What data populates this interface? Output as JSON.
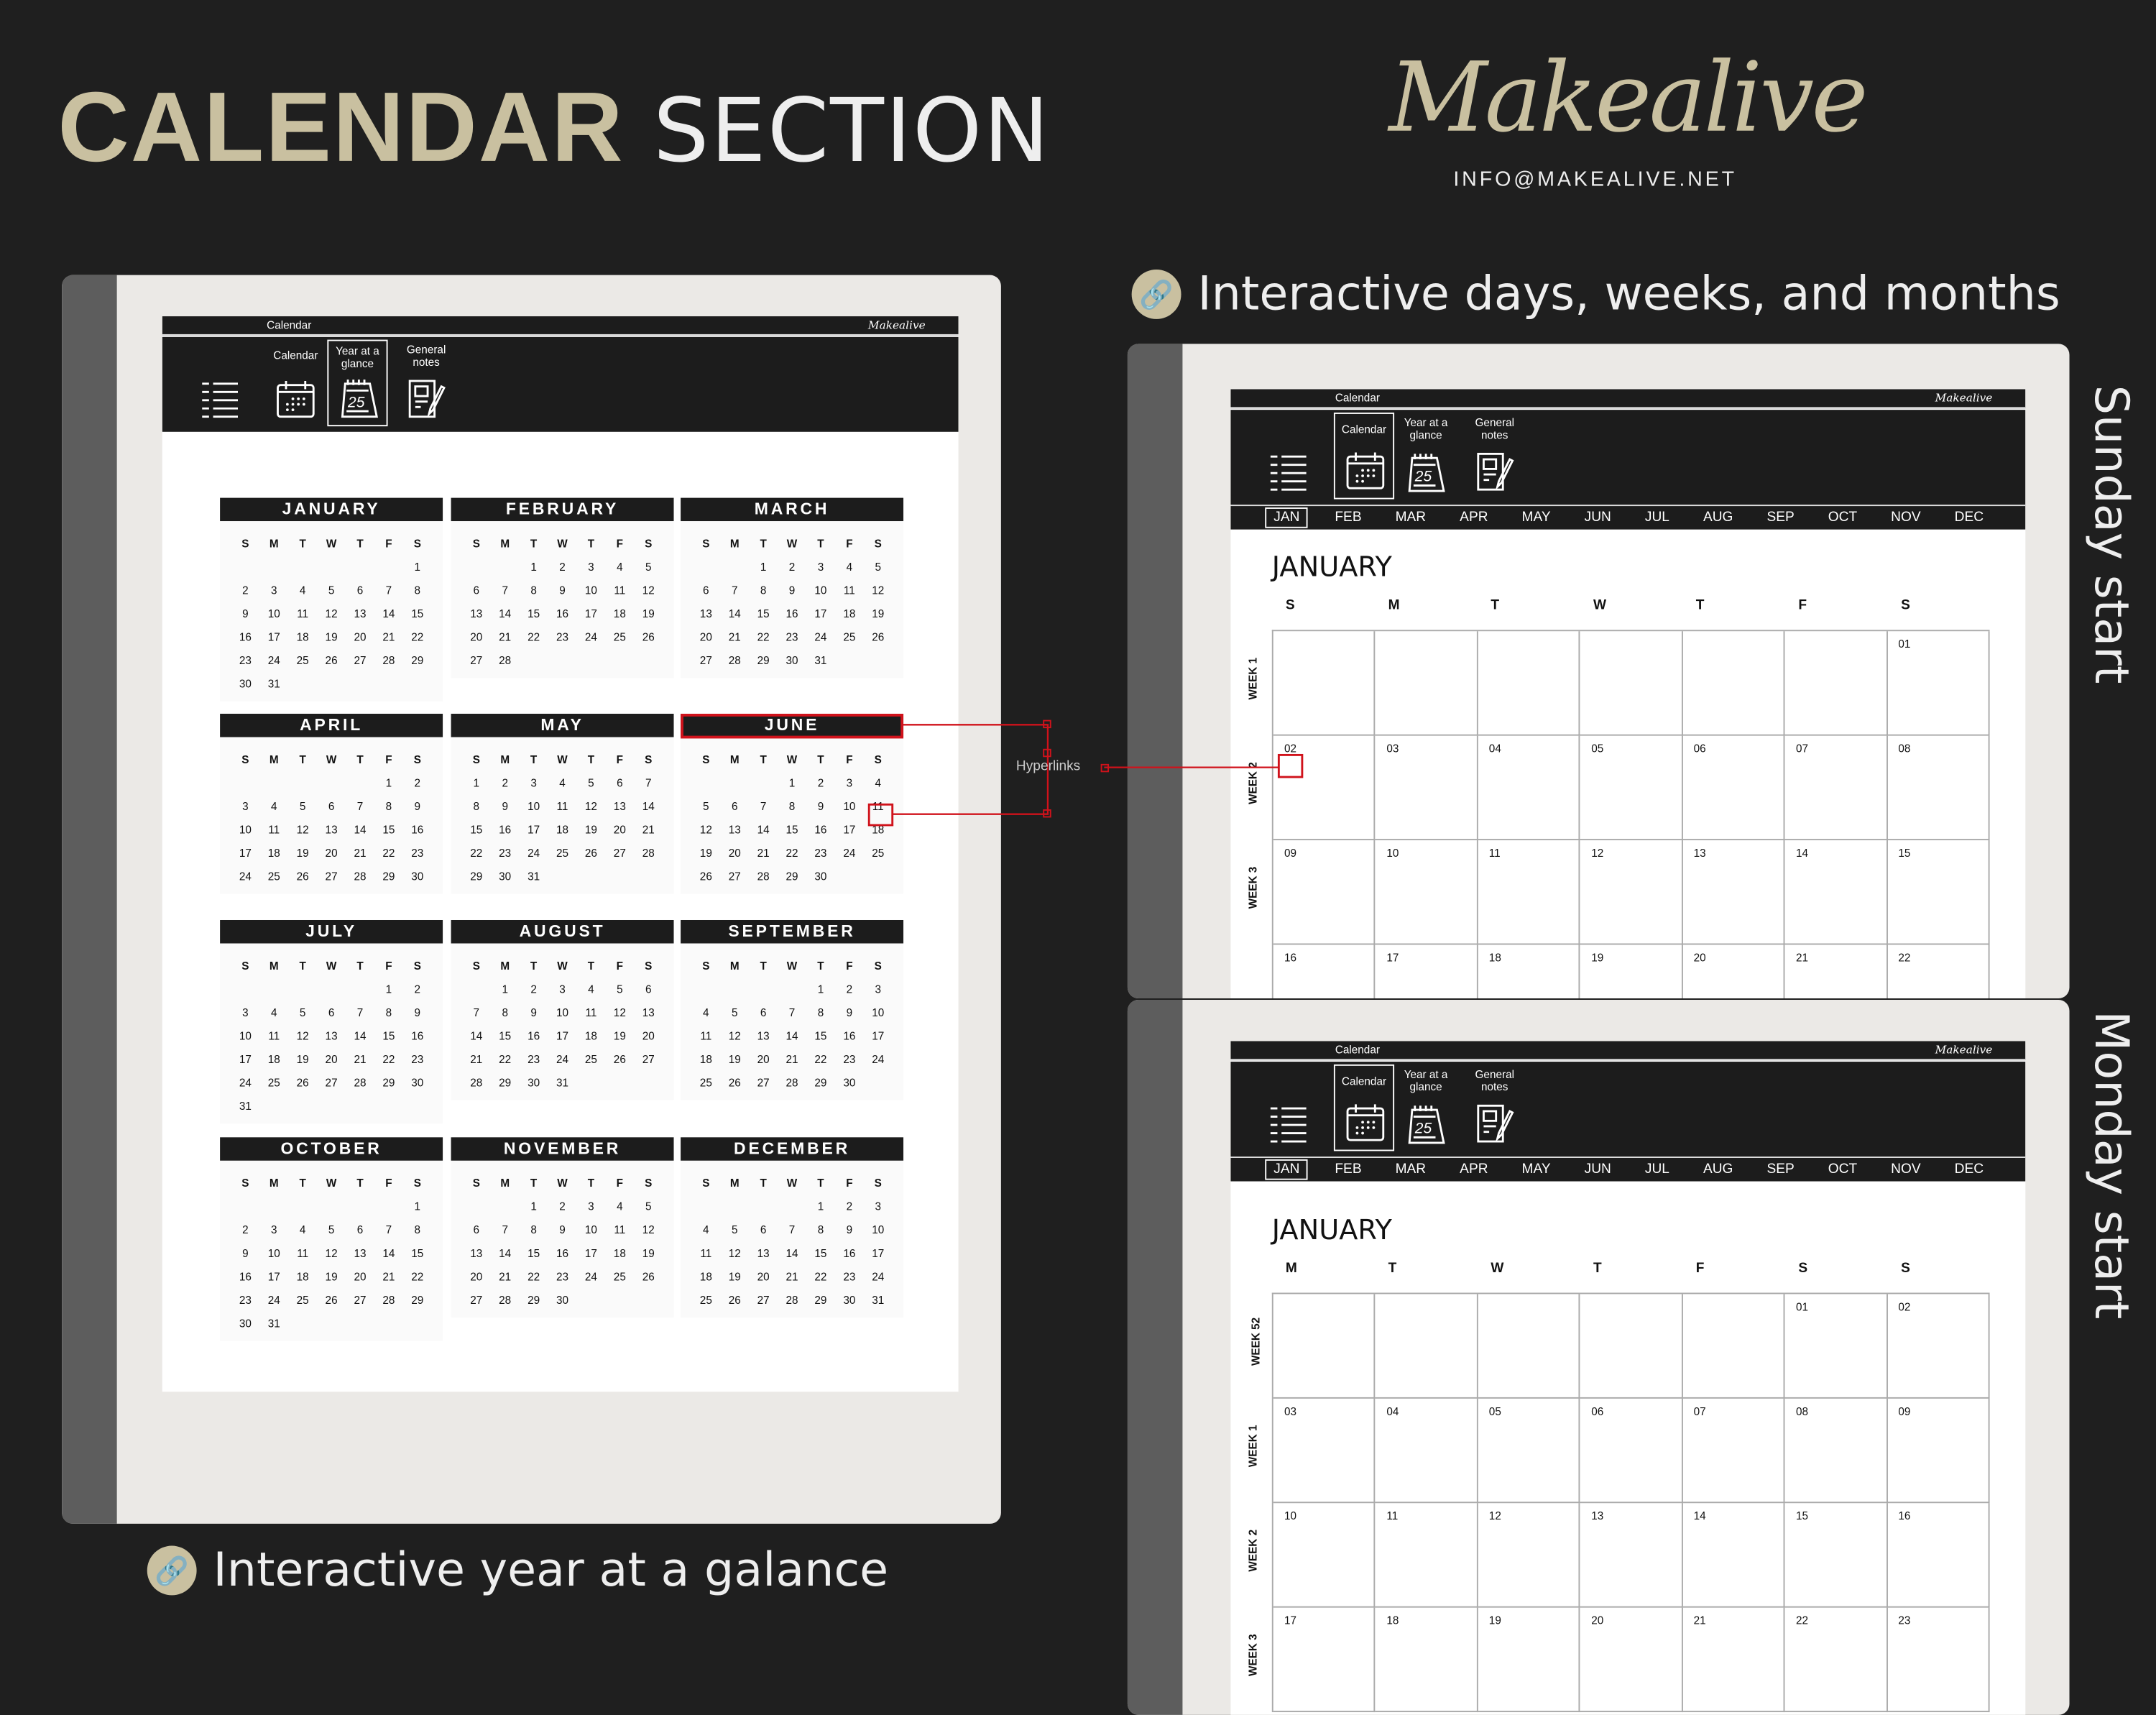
{
  "header": {
    "title_bold": "CALENDAR",
    "title_light": "SECTION",
    "brand": "Makealive",
    "email": "INFO@MAKEALIVE.NET"
  },
  "colors": {
    "accent": "#c9c0a0",
    "background": "#1f1f1f",
    "highlight": "#d0121b"
  },
  "captions": {
    "year": "Interactive year at a galance",
    "weeks": "Interactive days, weeks, and months",
    "sunday": "Sunday start",
    "monday": "Monday start",
    "hyperlinks": "Hyperlinks"
  },
  "page_header": {
    "title": "Calendar",
    "brand": "Makealive",
    "nav": [
      {
        "label": "",
        "icon": "list-icon"
      },
      {
        "label": "Calendar",
        "icon": "calendar-icon"
      },
      {
        "label": "Year at a glance",
        "icon": "desk-calendar-icon"
      },
      {
        "label": "General notes",
        "icon": "notes-icon"
      }
    ]
  },
  "weekdays_sun": [
    "S",
    "M",
    "T",
    "W",
    "T",
    "F",
    "S"
  ],
  "weekdays_mon": [
    "M",
    "T",
    "W",
    "T",
    "F",
    "S",
    "S"
  ],
  "month_tabs": [
    "JAN",
    "FEB",
    "MAR",
    "APR",
    "MAY",
    "JUN",
    "JUL",
    "AUG",
    "SEP",
    "OCT",
    "NOV",
    "DEC"
  ],
  "year_months": [
    {
      "name": "JANUARY",
      "first_weekday": 6,
      "days": 31
    },
    {
      "name": "FEBRUARY",
      "first_weekday": 2,
      "days": 28
    },
    {
      "name": "MARCH",
      "first_weekday": 2,
      "days": 31
    },
    {
      "name": "APRIL",
      "first_weekday": 5,
      "days": 30
    },
    {
      "name": "MAY",
      "first_weekday": 0,
      "days": 31
    },
    {
      "name": "JUNE",
      "first_weekday": 3,
      "days": 30
    },
    {
      "name": "JULY",
      "first_weekday": 5,
      "days": 31
    },
    {
      "name": "AUGUST",
      "first_weekday": 1,
      "days": 31
    },
    {
      "name": "SEPTEMBER",
      "first_weekday": 4,
      "days": 30
    },
    {
      "name": "OCTOBER",
      "first_weekday": 6,
      "days": 31
    },
    {
      "name": "NOVEMBER",
      "first_weekday": 2,
      "days": 30
    },
    {
      "name": "DECEMBER",
      "first_weekday": 4,
      "days": 31
    }
  ],
  "sunday_view": {
    "month": "JANUARY",
    "selected_tab": "JAN",
    "weeks": [
      {
        "label": "WEEK 1",
        "days": [
          "",
          "",
          "",
          "",
          "",
          "",
          "01"
        ]
      },
      {
        "label": "WEEK 2",
        "days": [
          "02",
          "03",
          "04",
          "05",
          "06",
          "07",
          "08"
        ]
      },
      {
        "label": "WEEK 3",
        "days": [
          "09",
          "10",
          "11",
          "12",
          "13",
          "14",
          "15"
        ]
      },
      {
        "label": "",
        "days": [
          "16",
          "17",
          "18",
          "19",
          "20",
          "21",
          "22"
        ]
      }
    ]
  },
  "monday_view": {
    "month": "JANUARY",
    "selected_tab": "JAN",
    "weeks": [
      {
        "label": "WEEK 52",
        "days": [
          "",
          "",
          "",
          "",
          "",
          "01",
          "02"
        ]
      },
      {
        "label": "WEEK 1",
        "days": [
          "03",
          "04",
          "05",
          "06",
          "07",
          "08",
          "09"
        ]
      },
      {
        "label": "WEEK 2",
        "days": [
          "10",
          "11",
          "12",
          "13",
          "14",
          "15",
          "16"
        ]
      },
      {
        "label": "WEEK 3",
        "days": [
          "17",
          "18",
          "19",
          "20",
          "21",
          "22",
          "23"
        ]
      }
    ]
  }
}
